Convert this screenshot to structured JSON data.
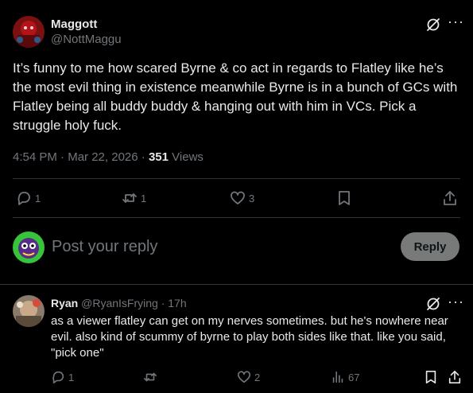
{
  "post": {
    "author_name": "Maggott",
    "author_handle": "@NottMaggu",
    "text": "It’s funny to me how scared Byrne & co act in regards to Flatley like he’s the most evil thing in existence meanwhile Byrne is in a bunch of GCs with Flatley being all buddy buddy & hanging out with him in VCs. Pick a struggle holy fuck.",
    "time": "4:54 PM",
    "separator1": "·",
    "date": "Mar 22, 2026",
    "separator2": "·",
    "views_count": "351",
    "views_label": "Views",
    "replies": "1",
    "reposts": "1",
    "likes": "3"
  },
  "compose": {
    "placeholder": "Post your reply",
    "reply_label": "Reply"
  },
  "reply": {
    "author_name": "Ryan",
    "author_handle": "@RyanIsFrying",
    "separator": "·",
    "age": "17h",
    "text": "as a viewer flatley can get on my nerves sometimes. but he's nowhere near evil. also kind of scummy of byrne to play both sides like that. like you said, \"pick one\"",
    "replies": "1",
    "likes": "2",
    "views": "67"
  },
  "icons": {
    "grok": "grok-icon",
    "more": "more-icon",
    "reply": "reply-icon",
    "repost": "repost-icon",
    "like": "heart-icon",
    "bookmark": "bookmark-icon",
    "share": "share-icon",
    "views": "views-icon"
  },
  "colors": {
    "background": "#000000",
    "text": "#e7e9ea",
    "muted": "#71767b",
    "divider": "#2f3336",
    "reply_button": "#787a7a"
  }
}
